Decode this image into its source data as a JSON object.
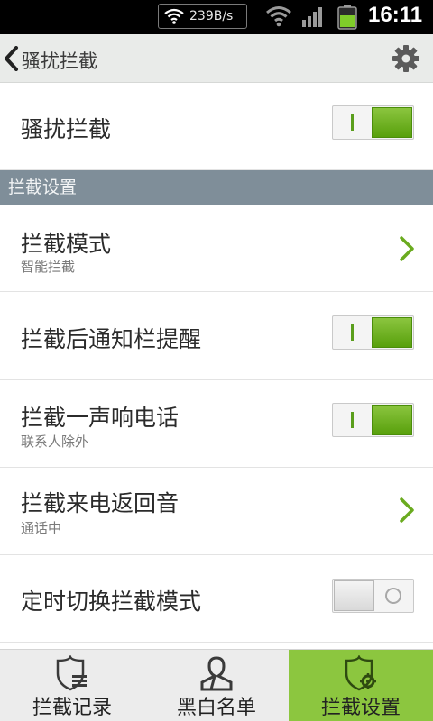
{
  "status_bar": {
    "net_speed": "239B/s",
    "time": "16:11"
  },
  "title_bar": {
    "title": "骚扰拦截"
  },
  "main_toggle": {
    "label": "骚扰拦截",
    "enabled": true
  },
  "section": {
    "header": "拦截设置"
  },
  "settings": [
    {
      "label": "拦截模式",
      "sub": "智能拦截",
      "control": "chevron"
    },
    {
      "label": "拦截后通知栏提醒",
      "sub": "",
      "control": "toggle",
      "enabled": true
    },
    {
      "label": "拦截一声响电话",
      "sub": "联系人除外",
      "control": "toggle",
      "enabled": true
    },
    {
      "label": "拦截来电返回音",
      "sub": "通话中",
      "control": "chevron"
    },
    {
      "label": "定时切换拦截模式",
      "sub": "",
      "control": "toggle",
      "enabled": false
    }
  ],
  "bottom_nav": [
    {
      "label": "拦截记录",
      "icon": "shield-list-icon",
      "active": false
    },
    {
      "label": "黑白名单",
      "icon": "contact-icon",
      "active": false
    },
    {
      "label": "拦截设置",
      "icon": "shield-gear-icon",
      "active": true
    }
  ],
  "colors": {
    "accent_green": "#8cc63f",
    "toggle_green": "#58a00c",
    "section_header": "#7f8e99"
  }
}
